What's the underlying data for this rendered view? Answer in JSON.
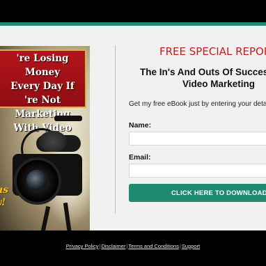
{
  "cover": {
    "headline": "'re Losing Money\nEvery Day If\n're Not Marketing\nWith Video",
    "script_text": "us\ny!"
  },
  "form": {
    "title": "FREE SPECIAL REPORT",
    "subtitle_line1": "The In's And Outs Of Successful O",
    "subtitle_line2": "Video Marketing",
    "intro": "Get my free eBook just by entering your details",
    "name_label": "Name:",
    "name_value": "",
    "email_label": "Email:",
    "email_value": "",
    "cta_label": "CLICK HERE TO DOWNLOAD"
  },
  "footer": {
    "links": [
      "Privacy Policy",
      "Disclaimer",
      "Terms and Conditions",
      "Support"
    ],
    "separator": "|"
  },
  "colors": {
    "accent": "#1f8a72",
    "title_red": "#c61c1c",
    "background": "#000000",
    "panel": "#f1f1f1"
  }
}
